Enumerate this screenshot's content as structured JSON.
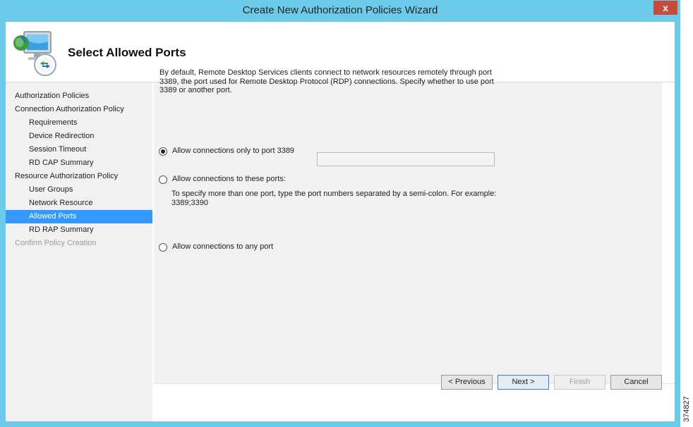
{
  "window": {
    "title": "Create New Authorization Policies Wizard",
    "close_label": "x"
  },
  "header": {
    "title": "Select Allowed Ports",
    "icon": "remote-desktop-computer-icon"
  },
  "nav": {
    "items": [
      {
        "label": "Authorization Policies",
        "level": 0,
        "state": "normal"
      },
      {
        "label": "Connection Authorization Policy",
        "level": 0,
        "state": "normal"
      },
      {
        "label": "Requirements",
        "level": 1,
        "state": "normal"
      },
      {
        "label": "Device Redirection",
        "level": 1,
        "state": "normal"
      },
      {
        "label": "Session Timeout",
        "level": 1,
        "state": "normal"
      },
      {
        "label": "RD CAP Summary",
        "level": 1,
        "state": "normal"
      },
      {
        "label": "Resource Authorization Policy",
        "level": 0,
        "state": "normal"
      },
      {
        "label": "User Groups",
        "level": 1,
        "state": "normal"
      },
      {
        "label": "Network Resource",
        "level": 1,
        "state": "normal"
      },
      {
        "label": "Allowed Ports",
        "level": 1,
        "state": "active"
      },
      {
        "label": "RD RAP Summary",
        "level": 1,
        "state": "normal"
      },
      {
        "label": "Confirm Policy Creation",
        "level": 0,
        "state": "disabled"
      }
    ]
  },
  "content": {
    "intro_line1": "By default, Remote Desktop Services clients connect to network resources remotely through port",
    "intro_line2": "3389, the port used for Remote Desktop Protocol (RDP) connections. Specify whether to use port",
    "intro_line3": "3389 or another port.",
    "option_only_3389": {
      "label": "Allow connections only to port 3389",
      "checked": true
    },
    "option_these_ports": {
      "label": "Allow connections to these ports:",
      "checked": false
    },
    "ports_input_value": "",
    "hint_line1": "To specify more than one port, type the port numbers separated by a semi-colon. For example:",
    "hint_line2": "3389;3390",
    "option_any_port": {
      "label": "Allow connections to any port",
      "checked": false
    }
  },
  "buttons": {
    "previous": "< Previous",
    "next": "Next >",
    "finish": "Finish",
    "cancel": "Cancel"
  },
  "figure_id": "374827",
  "colors": {
    "window_frame": "#6ccbea",
    "close_button": "#c74a3b",
    "selection": "#3399ff",
    "panel_background": "#f1f1f1"
  }
}
